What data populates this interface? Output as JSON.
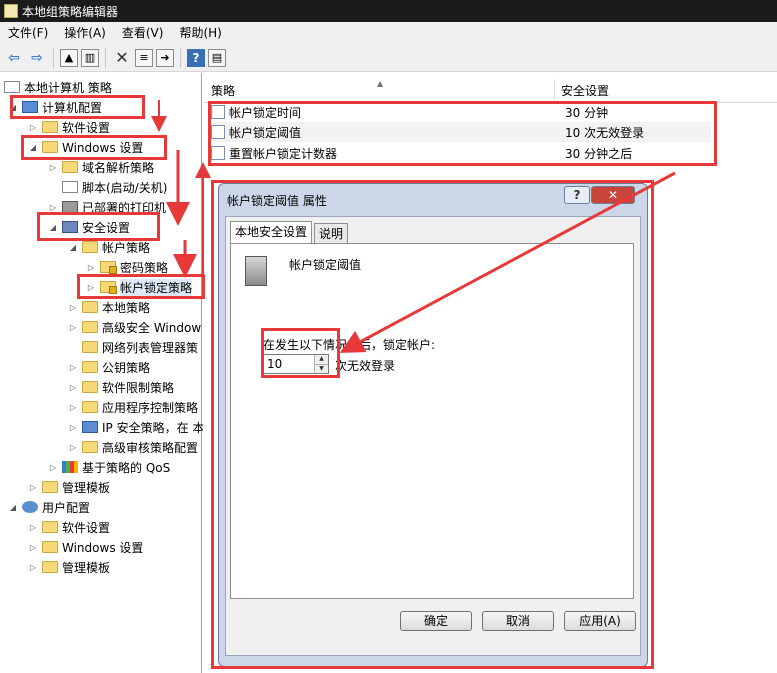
{
  "window": {
    "title": "本地组策略编辑器"
  },
  "menu": [
    "文件(F)",
    "操作(A)",
    "查看(V)",
    "帮助(H)"
  ],
  "toolbar": {
    "back_icon": "back-arrow-icon",
    "forward_icon": "forward-arrow-icon",
    "help_glyph": "?"
  },
  "tree": {
    "root": "本地计算机 策略",
    "computer_config": "计算机配置",
    "software_settings": "软件设置",
    "windows_settings": "Windows 设置",
    "dns": "域名解析策略",
    "scripts": "脚本(启动/关机)",
    "printers": "已部署的打印机",
    "security_settings": "安全设置",
    "account_policies": "帐户策略",
    "password_policy": "密码策略",
    "account_lockout_policy": "帐户锁定策略",
    "local_policies": "本地策略",
    "advanced_firewall": "高级安全 Window",
    "network_list": "网络列表管理器策",
    "public_key": "公钥策略",
    "software_restriction": "软件限制策略",
    "app_control": "应用程序控制策略",
    "ipsec": "IP 安全策略，在 本",
    "advanced_audit": "高级审核策略配置",
    "qos": "基于策略的 QoS",
    "admin_templates": "管理模板",
    "user_config": "用户配置",
    "user_software_settings": "软件设置",
    "user_windows_settings": "Windows 设置",
    "user_admin_templates": "管理模板"
  },
  "list": {
    "col_policy": "策略",
    "col_setting": "安全设置",
    "rows": [
      {
        "policy": "帐户锁定时间",
        "setting": "30 分钟"
      },
      {
        "policy": "帐户锁定阈值",
        "setting": "10 次无效登录"
      },
      {
        "policy": "重置帐户锁定计数器",
        "setting": "30 分钟之后"
      }
    ]
  },
  "dialog": {
    "title": "帐户锁定阈值 属性",
    "help_glyph": "?",
    "close_glyph": "✕",
    "tabs": [
      "本地安全设置",
      "说明"
    ],
    "policy_name": "帐户锁定阈值",
    "prompt": "在发生以下情况之后，锁定帐户:",
    "value": "10",
    "suffix": "次无效登录",
    "ok": "确定",
    "cancel": "取消",
    "apply": "应用(A)"
  },
  "annotation_color": "#e8393a"
}
